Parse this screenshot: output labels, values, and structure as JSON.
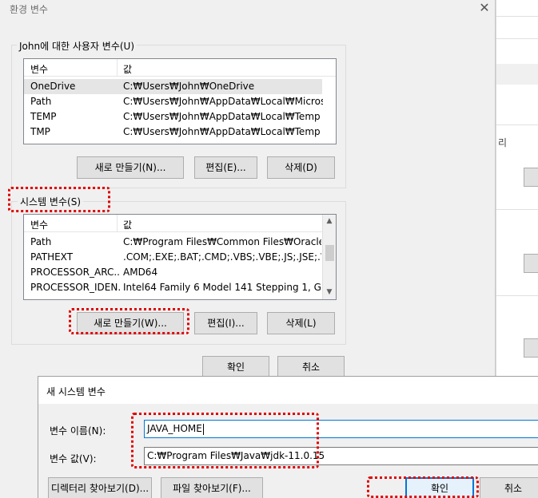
{
  "env_dialog": {
    "title": "환경 변수",
    "close_glyph": "✕",
    "user_group_label": "John에 대한 사용자 변수(U)",
    "system_group_label": "시스템 변수(S)",
    "col_variable": "변수",
    "col_value": "값",
    "user_vars": [
      {
        "name": "OneDrive",
        "value": "C:₩Users₩John₩OneDrive"
      },
      {
        "name": "Path",
        "value": "C:₩Users₩John₩AppData₩Local₩Microsof..."
      },
      {
        "name": "TEMP",
        "value": "C:₩Users₩John₩AppData₩Local₩Temp"
      },
      {
        "name": "TMP",
        "value": "C:₩Users₩John₩AppData₩Local₩Temp"
      }
    ],
    "system_vars": [
      {
        "name": "Path",
        "value": "C:₩Program Files₩Common Files₩Oracle₩..."
      },
      {
        "name": "PATHEXT",
        "value": ".COM;.EXE;.BAT;.CMD;.VBS;.VBE;.JS;.JSE;.W..."
      },
      {
        "name": "PROCESSOR_ARC...",
        "value": "AMD64"
      },
      {
        "name": "PROCESSOR_IDEN...",
        "value": "Intel64 Family 6 Model 141 Stepping 1, Ge..."
      }
    ],
    "user_buttons": {
      "new": "새로 만들기(N)...",
      "edit": "편집(E)...",
      "delete": "삭제(D)"
    },
    "system_buttons": {
      "new": "새로 만들기(W)...",
      "edit": "편집(I)...",
      "delete": "삭제(L)"
    },
    "ok": "확인",
    "cancel": "취소"
  },
  "background_window": {
    "partial_text": "리"
  },
  "new_var_dialog": {
    "title": "새 시스템 변수",
    "name_label": "변수 이름(N):",
    "name_value": "JAVA_HOME",
    "value_label": "변수 값(V):",
    "value_value": "C:₩Program Files₩Java₩jdk-11.0.15",
    "browse_dir": "디렉터리 찾아보기(D)...",
    "browse_file": "파일 찾아보기(F)...",
    "ok": "확인",
    "cancel": "취소"
  },
  "colors": {
    "highlight": "#e00000",
    "focus": "#0078d7"
  }
}
